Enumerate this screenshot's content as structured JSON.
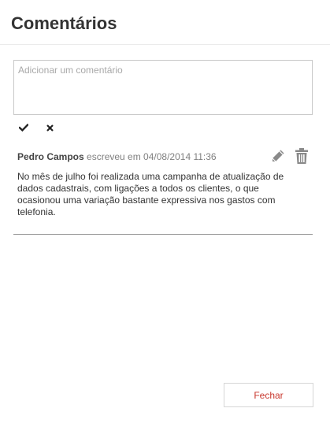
{
  "dialog": {
    "title": "Comentários"
  },
  "new_comment": {
    "placeholder": "Adicionar um comentário",
    "value": ""
  },
  "comment_actions": {
    "confirm_icon": "check-icon",
    "cancel_icon": "close-icon"
  },
  "comments": [
    {
      "author": "Pedro Campos",
      "meta": "escreveu em 04/08/2014 11:36",
      "text": "No mês de julho foi realizada uma campanha de atualização de dados cadastrais, com ligações a todos os clientes, o que ocasionou uma variação bastante expressiva nos gastos com telefonia.",
      "edit_icon": "pencil-icon",
      "delete_icon": "trash-icon"
    }
  ],
  "footer": {
    "close_label": "Fechar"
  },
  "colors": {
    "title": "#333333",
    "author": "#444444",
    "meta": "#808080",
    "close_button_text": "#c8372d",
    "icon_gray": "#8a8a8a"
  }
}
